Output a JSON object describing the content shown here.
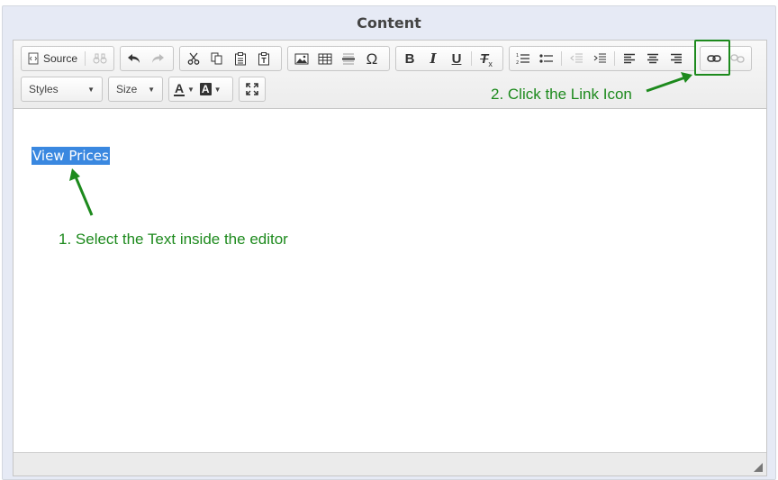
{
  "panel": {
    "title": "Content"
  },
  "toolbar": {
    "source_label": "Source",
    "styles_label": "Styles",
    "size_label": "Size",
    "icons": {
      "source": "source-icon",
      "find": "binoculars-icon",
      "undo": "undo-icon",
      "redo": "redo-icon",
      "cut": "cut-icon",
      "copy": "copy-icon",
      "paste": "paste-icon",
      "paste_text": "paste-text-icon",
      "image": "image-icon",
      "table": "table-icon",
      "hr": "horizontal-line-icon",
      "special_char": "omega-icon",
      "bold": "bold-icon",
      "italic": "italic-icon",
      "underline": "underline-icon",
      "remove_format": "remove-format-icon",
      "numbered_list": "numbered-list-icon",
      "bulleted_list": "bulleted-list-icon",
      "outdent": "outdent-icon",
      "indent": "indent-icon",
      "align_left": "align-left-icon",
      "align_center": "align-center-icon",
      "align_right": "align-right-icon",
      "link": "link-icon",
      "unlink": "unlink-icon",
      "text_color": "text-color-icon",
      "bg_color": "background-color-icon",
      "maximize": "maximize-icon"
    },
    "glyphs": {
      "bold": "B",
      "italic": "I",
      "underline": "U",
      "remove_format": "T",
      "special_char": "Ω",
      "text_color": "A",
      "bg_color": "A"
    }
  },
  "editor": {
    "selected_text": "View Prices"
  },
  "annotations": {
    "step1": "1. Select the Text inside the editor",
    "step2": "2. Click the Link Icon"
  },
  "colors": {
    "annotation": "#1d8a1d",
    "selection": "#3a88e0",
    "frame_bg": "#e6eaf5"
  }
}
